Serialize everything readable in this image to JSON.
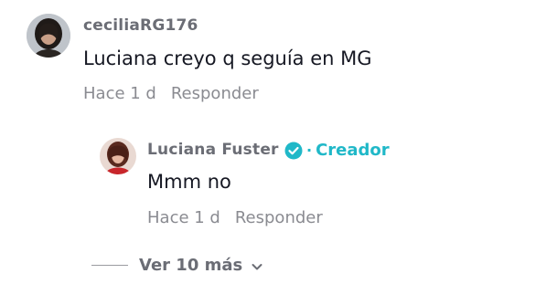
{
  "comment": {
    "username": "ceciliaRG176",
    "text": "Luciana creyo q seguía en MG",
    "time": "Hace 1 d",
    "reply_label": "Responder",
    "avatar_icon": "avatar-photo"
  },
  "reply": {
    "username": "Luciana Fuster",
    "verified_icon": "verified-check-icon",
    "creator_separator": "·",
    "creator_label": "Creador",
    "text": "Mmm no",
    "time": "Hace 1 d",
    "reply_label": "Responder",
    "avatar_icon": "avatar-photo"
  },
  "view_more": {
    "label": "Ver 10 más",
    "icon": "chevron-down-icon"
  },
  "colors": {
    "accent": "#20b8c8",
    "text_primary": "#161823",
    "text_secondary": "#8a8b91",
    "username": "#6b6d75"
  }
}
